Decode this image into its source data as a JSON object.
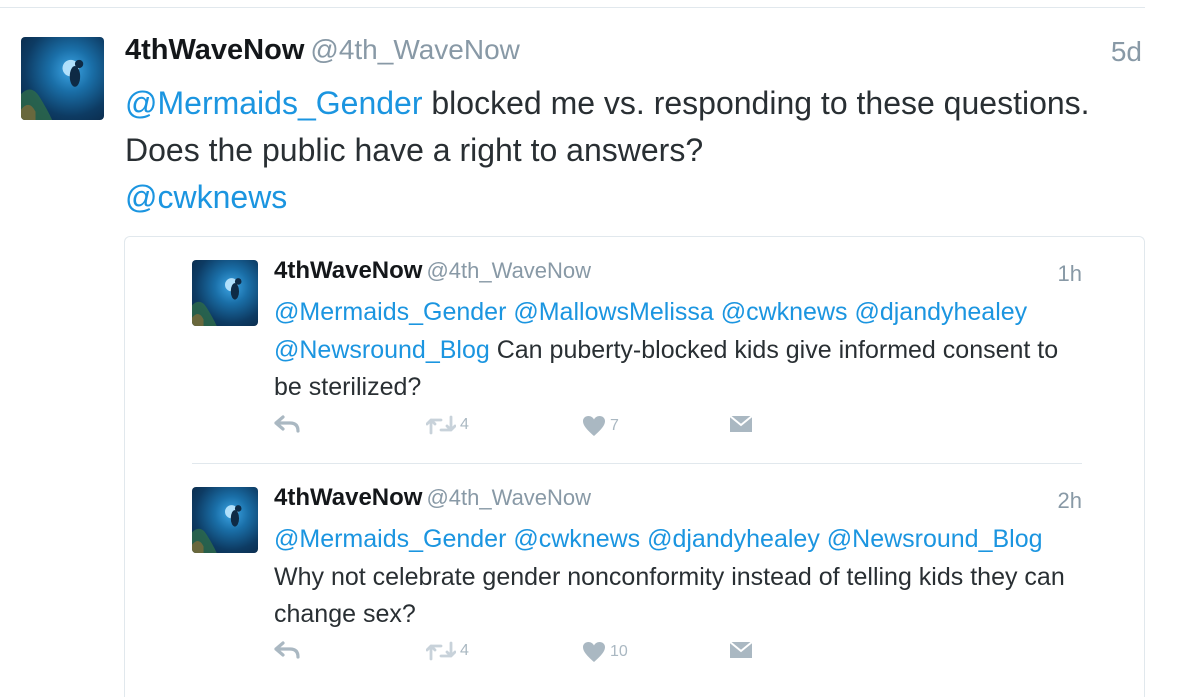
{
  "main_tweet": {
    "name": "4thWaveNow",
    "handle": "@4th_WaveNow",
    "time": "5d",
    "mention_1": "@Mermaids_Gender",
    "text_body": " blocked me vs. responding to these questions. Does the public have a right to answers?",
    "mention_2": "@cwknews"
  },
  "quoted_tweets": [
    {
      "name": "4thWaveNow",
      "handle": "@4th_WaveNow",
      "time": "1h",
      "mentions": "@Mermaids_Gender @MallowsMelissa @cwknews @djandyhealey @Newsround_Blog",
      "text": " Can puberty-blocked kids give informed consent to be sterilized?",
      "retweet_count": "4",
      "like_count": "7",
      "icons": [
        "reply-icon",
        "retweet-icon",
        "like-icon",
        "message-icon"
      ]
    },
    {
      "name": "4thWaveNow",
      "handle": "@4th_WaveNow",
      "time": "2h",
      "mentions": "@Mermaids_Gender @cwknews @djandyhealey @Newsround_Blog",
      "text": " Why not celebrate gender nonconformity instead of telling kids they can change sex?",
      "retweet_count": "4",
      "like_count": "10",
      "icons": [
        "reply-icon",
        "retweet-icon",
        "like-icon",
        "message-icon"
      ]
    }
  ],
  "colors": {
    "link": "#1b95e0",
    "muted": "#8899a6",
    "icon": "#aab8c2",
    "divider": "#e1e8ed"
  }
}
